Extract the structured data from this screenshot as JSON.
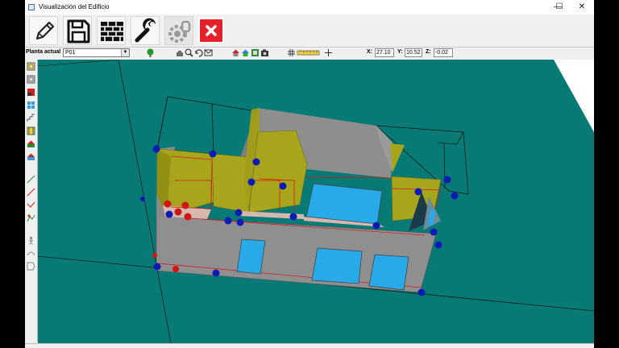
{
  "window": {
    "title": "Visualización del Edificio",
    "controls": [
      "—",
      "☐",
      "✕"
    ]
  },
  "toolbar": {
    "buttons": [
      {
        "name": "edit",
        "icon": "pencil-icon"
      },
      {
        "name": "save",
        "icon": "floppy-disk-icon"
      },
      {
        "name": "walls",
        "icon": "brick-wall-icon"
      },
      {
        "name": "tools",
        "icon": "wrench-icon"
      },
      {
        "name": "settings",
        "icon": "gear-key-icon",
        "disabled": true
      },
      {
        "name": "close",
        "icon": "close-x-icon",
        "color": "#e5212b"
      }
    ]
  },
  "floorbar": {
    "label": "Planta actual",
    "selected_floor": "P01"
  },
  "coords": {
    "x_label": "X:",
    "x_value": "27.10",
    "y_label": "Y:",
    "y_value": "10.52",
    "z_label": "Z:",
    "z_value": "-0.02"
  },
  "colors": {
    "viewport_bg": "#077a75",
    "wall_gray": "#8f8f8f",
    "roof_olive": "#a7a51c",
    "window_blue": "#27a9ea",
    "node_blue": "#0b1ab3",
    "node_red": "#d01515"
  }
}
